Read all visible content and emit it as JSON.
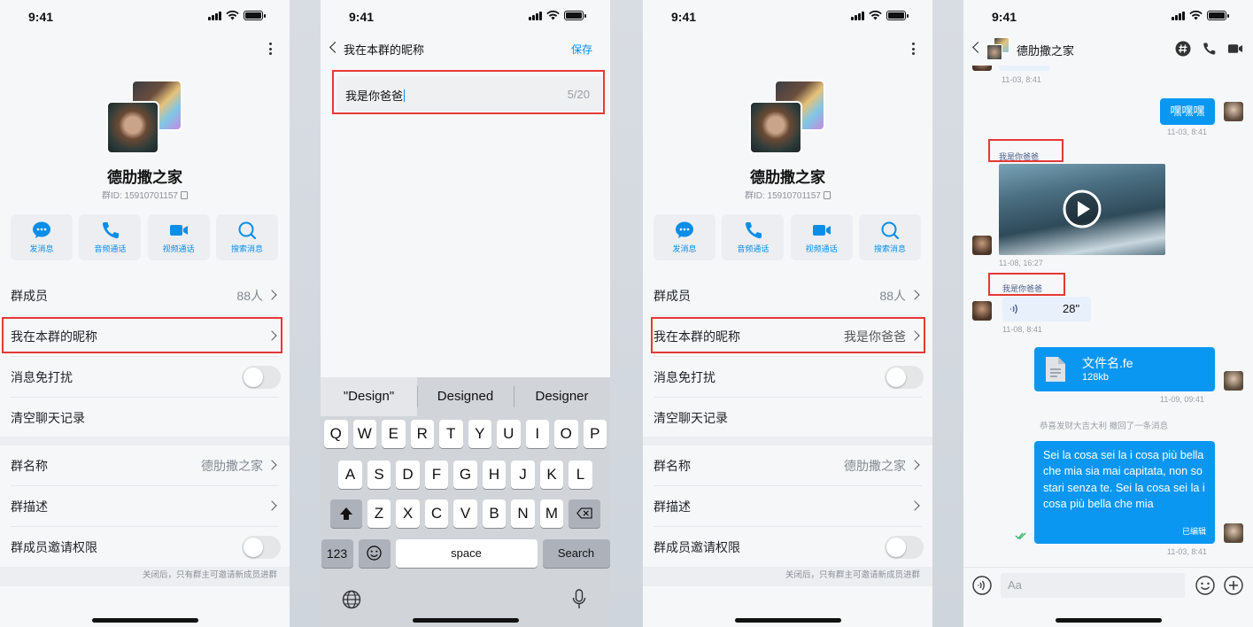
{
  "colors": {
    "accent": "#0a97f2",
    "link": "#0a8ee8",
    "highlight": "#e53935",
    "bubble_in": "#e8f0fc"
  },
  "status": {
    "time": "9:41"
  },
  "group_info": {
    "group_name": "德肋撒之家",
    "group_id": "群ID: 15910701157",
    "actions": [
      {
        "label": "发消息",
        "icon": "chat-bubble-icon"
      },
      {
        "label": "音频通话",
        "icon": "phone-icon"
      },
      {
        "label": "视频通话",
        "icon": "video-camera-icon"
      },
      {
        "label": "搜索消息",
        "icon": "search-icon"
      }
    ],
    "members_label": "群成员",
    "members_value": "88人",
    "nickname_label": "我在本群的昵称",
    "mute_label": "消息免打扰",
    "clear_label": "清空聊天记录",
    "groupname_label": "群名称",
    "groupname_value": "德肋撒之家",
    "desc_label": "群描述",
    "invite_label": "群成员邀请权限",
    "invite_note": "关闭后，只有群主可邀请新成员进群"
  },
  "group_info_after": {
    "nickname_value": "我是你爸爸"
  },
  "nickname_edit": {
    "title": "我在本群的昵称",
    "save_label": "保存",
    "input_value": "我是你爸爸",
    "counter": "5/20"
  },
  "keyboard": {
    "suggestions": [
      "\"Design\"",
      "Designed",
      "Designer"
    ],
    "row1": [
      "Q",
      "W",
      "E",
      "R",
      "T",
      "Y",
      "U",
      "I",
      "O",
      "P"
    ],
    "row2": [
      "A",
      "S",
      "D",
      "F",
      "G",
      "H",
      "J",
      "K",
      "L"
    ],
    "row3": [
      "Z",
      "X",
      "C",
      "V",
      "B",
      "N",
      "M"
    ],
    "num_label": "123",
    "space_label": "space",
    "search_label": "Search"
  },
  "chat": {
    "title": "德肋撒之家",
    "time1": "11-03, 8:41",
    "msg_hey": "嘿嘿嘿",
    "time2": "11-03, 8:41",
    "nick1": "我是你爸爸",
    "time3": "11-08, 16:27",
    "nick2": "我是你爸爸",
    "voice_duration": "28\"",
    "time4": "11-08, 8:41",
    "file_name": "文件名.fe",
    "file_size": "128kb",
    "time5": "11-09, 09:41",
    "recall_name": "恭喜发财大吉大利",
    "recall_text": "撤回了一条消息",
    "long_text": "Sei la cosa sei la i cosa più bella che mia sia mai capitata, non so stari senza te. Sei la cosa sei la i cosa più bella che mia",
    "edited_label": "已编辑",
    "time6": "11-03, 8:41",
    "input_placeholder": "Aa"
  }
}
